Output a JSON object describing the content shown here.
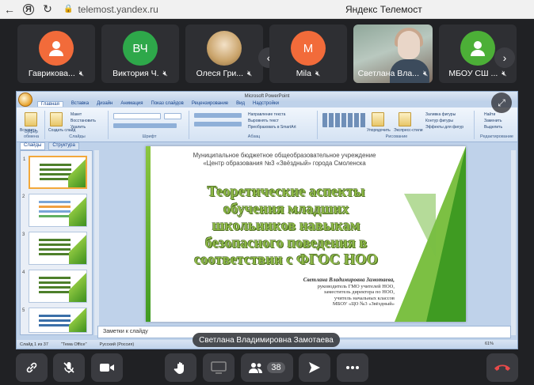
{
  "browser": {
    "back_icon": "arrow-left-icon",
    "ya_label": "Я",
    "reload_icon": "reload-icon",
    "lock_icon": "lock-icon",
    "url": "telemost.yandex.ru",
    "title": "Яндекс Телемост"
  },
  "participants": [
    {
      "name": "Гаврикова...",
      "avatar_type": "person-icon",
      "color": "#f26b3a",
      "muted": true
    },
    {
      "name": "Виктория Ч.",
      "avatar_text": "ВЧ",
      "color": "#2ea84a",
      "muted": true
    },
    {
      "name": "Олеся Гри...",
      "avatar_type": "photo",
      "muted": true
    },
    {
      "name": "Mila",
      "avatar_text": "M",
      "color": "#f26b3a",
      "muted": true
    },
    {
      "name": "Светлана Вла...",
      "avatar_type": "video",
      "muted": true
    },
    {
      "name": "МБОУ СШ ...",
      "avatar_type": "person-icon",
      "color": "#4caf37",
      "muted": true
    }
  ],
  "strip_prev_icon": "chevron-left-icon",
  "strip_next_icon": "chevron-right-icon",
  "ppt": {
    "window_title": "Microsoft PowerPoint",
    "tabs": [
      "Главная",
      "Вставка",
      "Дизайн",
      "Анимация",
      "Показ слайдов",
      "Рецензирование",
      "Вид",
      "Надстройки"
    ],
    "ribbon": {
      "paste": "Вставить",
      "create_slide": "Создать слайд",
      "layout": "Макет",
      "reset": "Восстановить",
      "delete": "Удалить",
      "clipboard": "Буфер обмена",
      "slides": "Слайды",
      "font": "Шрифт",
      "paragraph": "Абзац",
      "text_direction": "Направление текста",
      "align_text": "Выровнять текст",
      "smartart": "Преобразовать в SmartArt",
      "arrange": "Упорядочить",
      "quick_styles": "Экспресс-стили",
      "fill": "Заливка фигуры",
      "outline": "Контур фигуры",
      "effects": "Эффекты для фигур",
      "drawing": "Рисование",
      "find": "Найти",
      "replace": "Заменить",
      "select": "Выделить",
      "editing": "Редактирование"
    },
    "side_tabs": [
      "Слайды",
      "Структура"
    ],
    "slide": {
      "org_line1": "Муниципальное бюджетное общеобразовательное учреждение",
      "org_line2": "«Центр образования №3 «Звёздный» города Смоленска",
      "title_line1": "Теоретические аспекты",
      "title_line2": "обучения младших",
      "title_line3": "школьников навыкам",
      "title_line4": "безопасного поведения в",
      "title_line5": "соответствии с ФГОС НОО",
      "author_name": "Светлана Владимировна Замотаева,",
      "author_line1": "руководитель ГМО учителей НОО,",
      "author_line2": "заместитель директора по НОО,",
      "author_line3": "учитель начальных классов",
      "author_line4": "МБОУ «ЦО №3 «Звёздный»"
    },
    "notes_placeholder": "Заметки к слайду",
    "status_slide": "Слайд 1 из 37",
    "status_theme": "\"Тема Office\"",
    "status_lang": "Русский (Россия)",
    "status_zoom": "61%"
  },
  "expand_icon": "expand-icon",
  "speaker_label": "Светлана Владимировна Замотаева",
  "toolbar": {
    "link_icon": "link-icon",
    "mic_icon": "mic-off-icon",
    "camera_icon": "camera-icon",
    "hand_icon": "raise-hand-icon",
    "screen_icon": "screen-share-icon",
    "people_icon": "people-icon",
    "participant_count": "38",
    "send_icon": "send-icon",
    "more_icon": "more-icon",
    "end_icon": "end-call-icon"
  },
  "colors": {
    "end_call": "#e84a4a",
    "title_green": "#8db848",
    "accent_green": "#3f9b22"
  }
}
